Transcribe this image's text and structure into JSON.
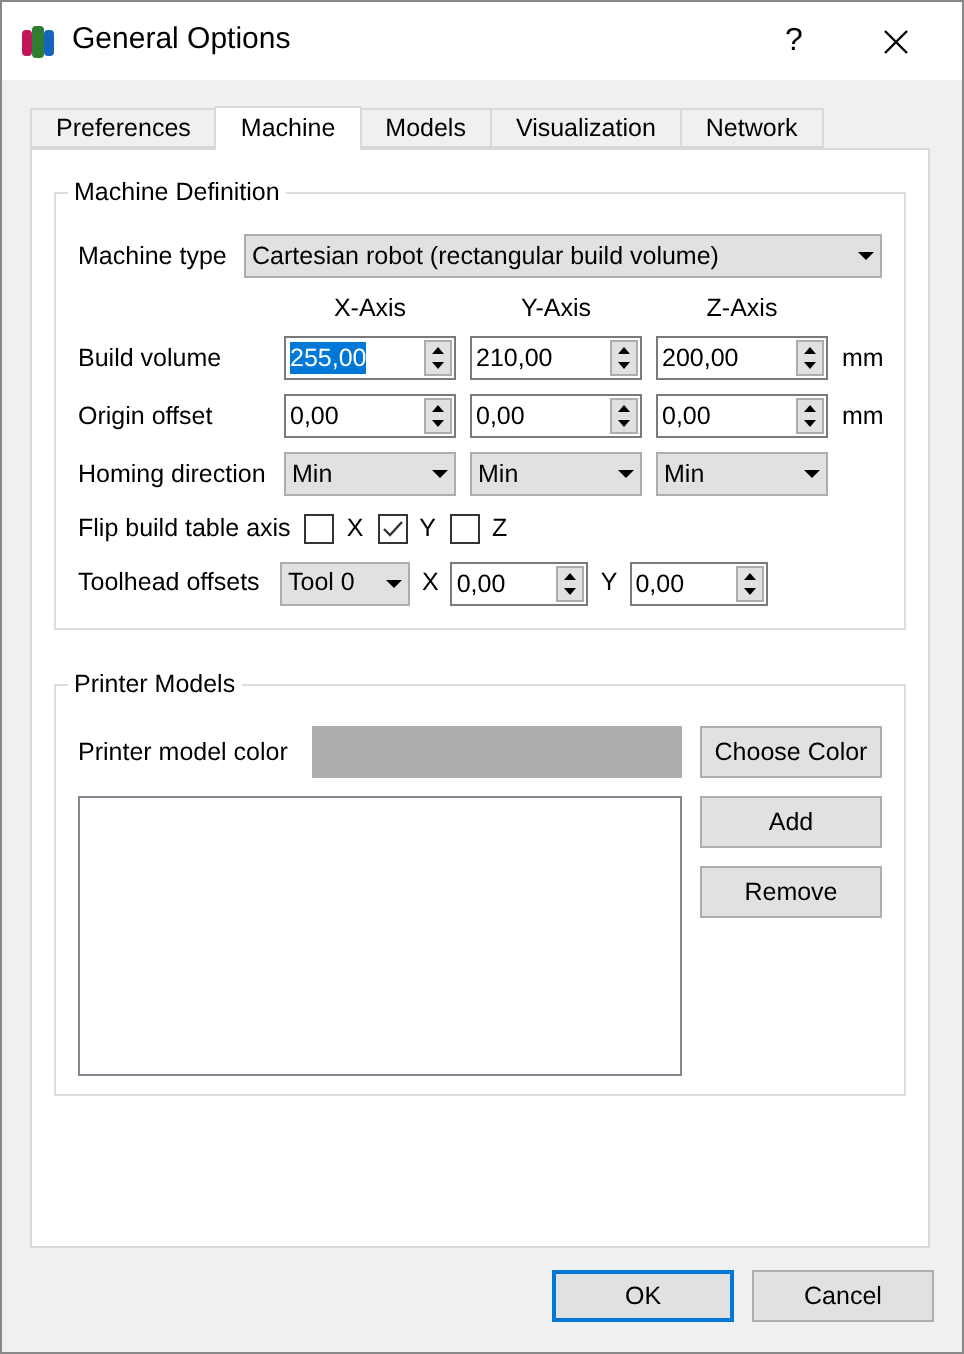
{
  "window": {
    "title": "General Options",
    "help": "?"
  },
  "tabs": [
    {
      "label": "Preferences",
      "selected": false
    },
    {
      "label": "Machine",
      "selected": true
    },
    {
      "label": "Models",
      "selected": false
    },
    {
      "label": "Visualization",
      "selected": false
    },
    {
      "label": "Network",
      "selected": false
    }
  ],
  "machine_definition": {
    "title": "Machine Definition",
    "machine_type": {
      "label": "Machine type",
      "value": "Cartesian robot (rectangular build volume)"
    },
    "axis_headers": [
      "X-Axis",
      "Y-Axis",
      "Z-Axis"
    ],
    "build_volume": {
      "label": "Build volume",
      "unit": "mm",
      "values": [
        {
          "value": "255,00",
          "selected": true
        },
        {
          "value": "210,00",
          "selected": false
        },
        {
          "value": "200,00",
          "selected": false
        }
      ]
    },
    "origin_offset": {
      "label": "Origin offset",
      "unit": "mm",
      "values": [
        {
          "value": "0,00",
          "selected": false
        },
        {
          "value": "0,00",
          "selected": false
        },
        {
          "value": "0,00",
          "selected": false
        }
      ]
    },
    "homing_direction": {
      "label": "Homing direction",
      "values": [
        "Min",
        "Min",
        "Min"
      ]
    },
    "flip_build_table_axis": {
      "label": "Flip build table axis",
      "options": [
        {
          "label": "X",
          "checked": false
        },
        {
          "label": "Y",
          "checked": true
        },
        {
          "label": "Z",
          "checked": false
        }
      ]
    },
    "toolhead_offsets": {
      "label": "Toolhead offsets",
      "tool": "Tool 0",
      "fields": [
        {
          "label": "X",
          "value": "0,00"
        },
        {
          "label": "Y",
          "value": "0,00"
        }
      ]
    }
  },
  "printer_models": {
    "title": "Printer Models",
    "color_label": "Printer model color",
    "color": "#adadad",
    "buttons": [
      "Choose Color",
      "Add",
      "Remove"
    ]
  },
  "footer_buttons": [
    {
      "label": "OK",
      "default": true
    },
    {
      "label": "Cancel",
      "default": false
    }
  ]
}
